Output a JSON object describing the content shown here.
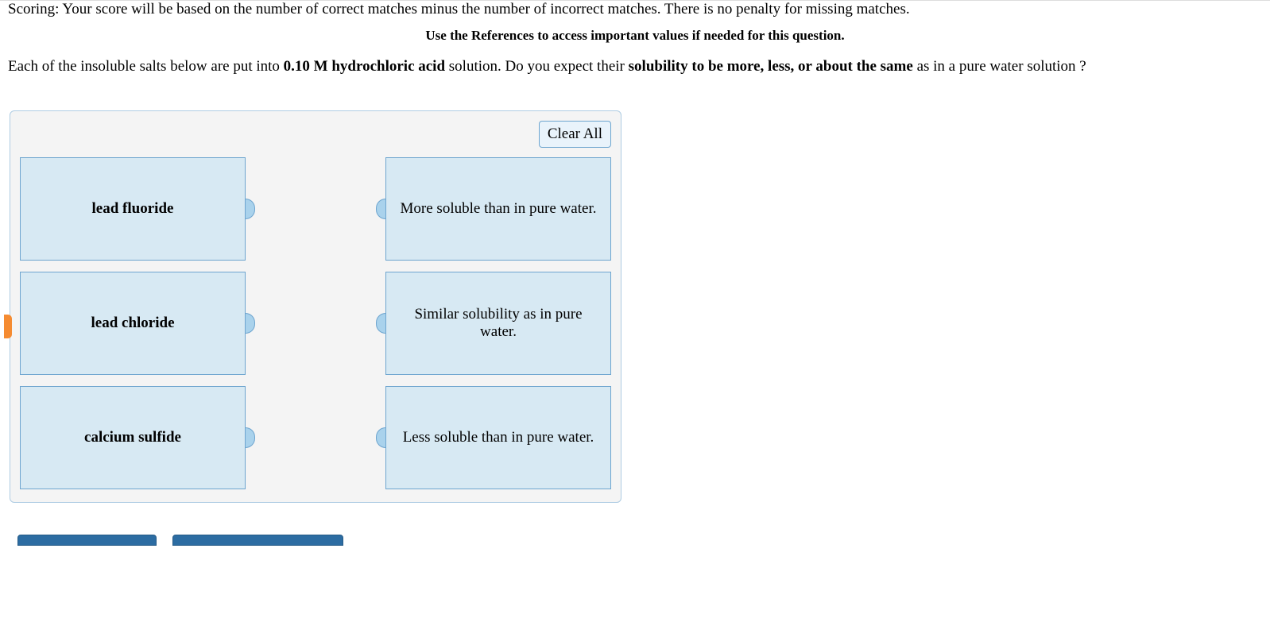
{
  "scoring_text": "Scoring: Your score will be based on the number of correct matches minus the number of incorrect matches. There is no penalty for missing matches.",
  "references_text": "Use the References to access important values if needed for this question.",
  "question": {
    "prefix": "Each of the insoluble salts below are put into ",
    "bold1": "0.10 M hydrochloric acid",
    "mid": " solution. Do you expect their ",
    "bold2": "solubility to be more, less, or about the same",
    "suffix": " as in a pure water solution ?"
  },
  "clear_label": "Clear All",
  "left_items": [
    "lead fluoride",
    "lead chloride",
    "calcium sulfide"
  ],
  "right_items": [
    "More soluble than in pure water.",
    "Similar solubility as in pure water.",
    "Less soluble than in pure water."
  ]
}
